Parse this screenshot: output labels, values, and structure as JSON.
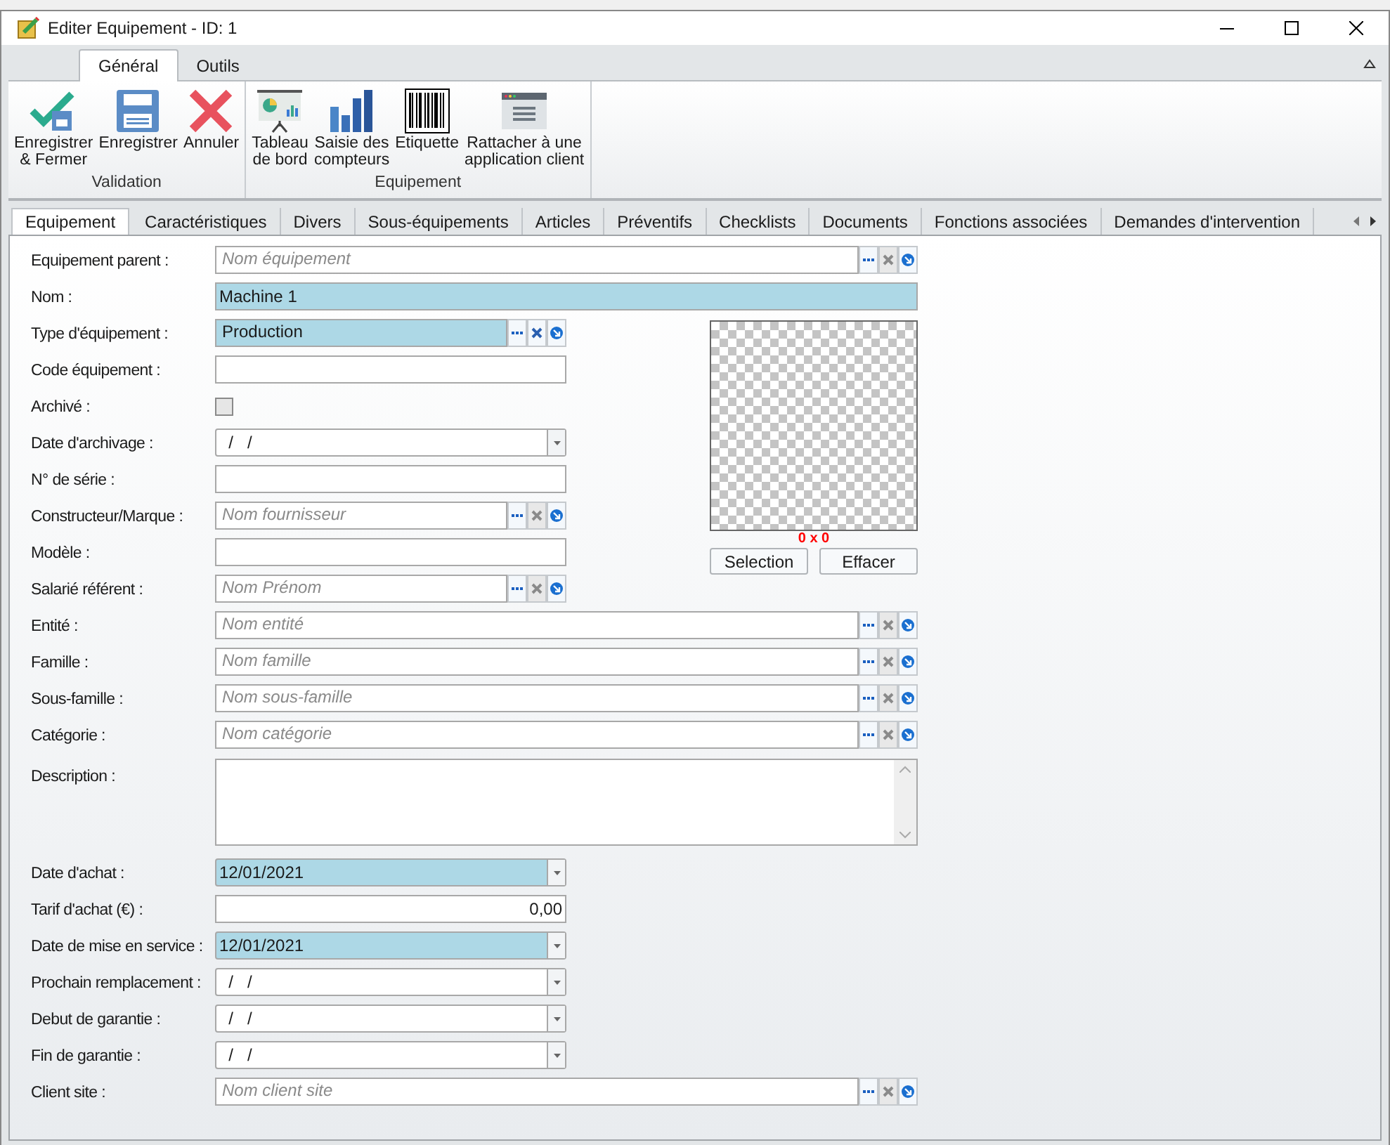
{
  "window": {
    "title": "Editer Equipement - ID: 1"
  },
  "ribbon": {
    "tabs": [
      {
        "label": "Général",
        "selected": true
      },
      {
        "label": "Outils",
        "selected": false
      }
    ],
    "groups": [
      {
        "label": "Validation",
        "buttons": [
          {
            "label": "Enregistrer\n& Fermer"
          },
          {
            "label": "Enregistrer"
          },
          {
            "label": "Annuler"
          }
        ]
      },
      {
        "label": "Equipement",
        "buttons": [
          {
            "label": "Tableau\nde bord"
          },
          {
            "label": "Saisie des\ncompteurs"
          },
          {
            "label": "Etiquette"
          },
          {
            "label": "Rattacher à une\napplication client"
          }
        ]
      }
    ]
  },
  "tabs": [
    {
      "label": "Equipement",
      "selected": true
    },
    {
      "label": "Caractéristiques",
      "selected": false
    },
    {
      "label": "Divers",
      "selected": false
    },
    {
      "label": "Sous-équipements",
      "selected": false
    },
    {
      "label": "Articles",
      "selected": false
    },
    {
      "label": "Préventifs",
      "selected": false
    },
    {
      "label": "Checklists",
      "selected": false
    },
    {
      "label": "Documents",
      "selected": false
    },
    {
      "label": "Fonctions associées",
      "selected": false
    },
    {
      "label": "Demandes d'intervention",
      "selected": false
    }
  ],
  "form": {
    "top_fields": [
      {
        "label": "Equipement parent :",
        "kind": "lookup",
        "placeholder": "Nom équipement",
        "highlighted": false
      },
      {
        "label": "Nom :",
        "kind": "text",
        "value": "Machine 1",
        "highlighted": true
      }
    ],
    "side_fields": [
      {
        "label": "Type d'équipement :",
        "kind": "lookup",
        "value": "Production",
        "highlighted": true
      },
      {
        "label": "Code équipement :",
        "kind": "text",
        "highlighted": false
      },
      {
        "label": "Archivé :",
        "kind": "checkbox",
        "checked": false
      },
      {
        "label": "Date d'archivage :",
        "kind": "date",
        "value": "  /   /",
        "highlighted": false
      },
      {
        "label": "N° de série :",
        "kind": "text",
        "highlighted": false
      },
      {
        "label": "Constructeur/Marque :",
        "kind": "lookup",
        "placeholder": "Nom fournisseur",
        "highlighted": false
      },
      {
        "label": "Modèle :",
        "kind": "text",
        "highlighted": false
      },
      {
        "label": "Salarié référent :",
        "kind": "lookup",
        "placeholder": "Nom Prénom",
        "highlighted": false
      }
    ],
    "image": {
      "size": "0 x 0",
      "buttons": [
        "Selection",
        "Effacer"
      ]
    },
    "bottom_fields": [
      {
        "label": "Entité :",
        "kind": "lookup",
        "placeholder": "Nom entité",
        "highlighted": false
      },
      {
        "label": "Famille :",
        "kind": "lookup",
        "placeholder": "Nom famille",
        "highlighted": false
      },
      {
        "label": "Sous-famille :",
        "kind": "lookup",
        "placeholder": "Nom sous-famille",
        "highlighted": false
      },
      {
        "label": "Catégorie :",
        "kind": "lookup",
        "placeholder": "Nom catégorie",
        "highlighted": false
      },
      {
        "label": "Description :",
        "kind": "textarea",
        "highlighted": false
      },
      {
        "label": "Date d'achat :",
        "kind": "date",
        "value": "12/01/2021",
        "highlighted": true
      },
      {
        "label": "Tarif d'achat (€) :",
        "kind": "number",
        "value": "0,00",
        "highlighted": false
      },
      {
        "label": "Date de mise en service :",
        "kind": "date",
        "value": "12/01/2021",
        "highlighted": true
      },
      {
        "label": "Prochain remplacement :",
        "kind": "date",
        "value": "  /   /",
        "highlighted": false
      },
      {
        "label": "Debut de garantie :",
        "kind": "date",
        "value": "  /   /",
        "highlighted": false
      },
      {
        "label": "Fin de garantie :",
        "kind": "date",
        "value": "  /   /",
        "highlighted": false
      },
      {
        "label": "Client site :",
        "kind": "lookup",
        "placeholder": "Nom client site",
        "highlighted": false
      }
    ]
  }
}
